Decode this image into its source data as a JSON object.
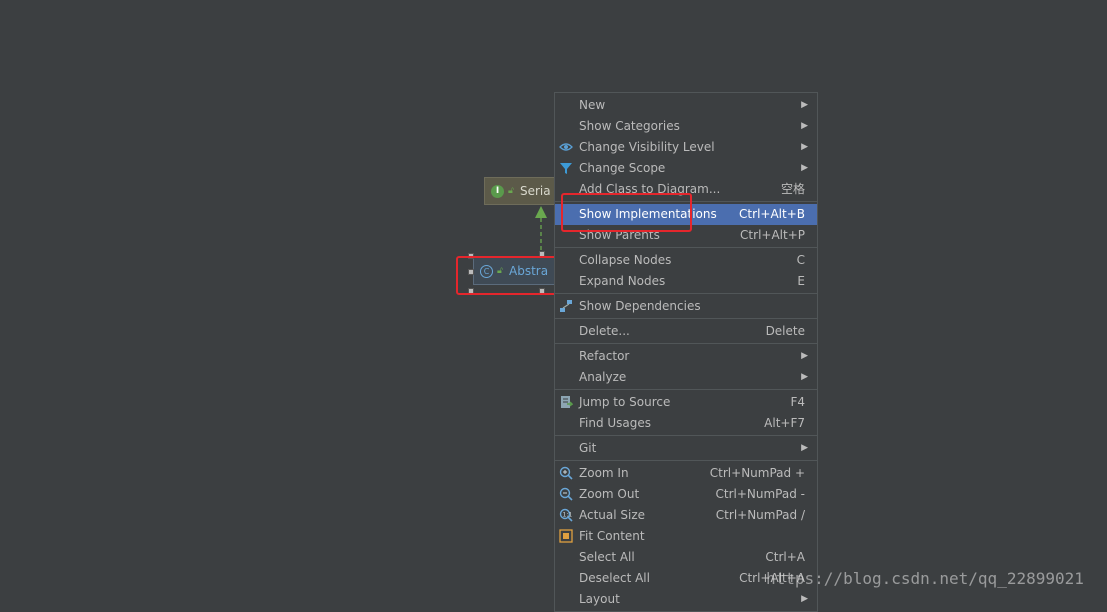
{
  "diagram": {
    "nodes": [
      {
        "label": "Seria",
        "badge": "I"
      },
      {
        "label": "Abstra",
        "badge": "C"
      }
    ]
  },
  "menu": {
    "groups": [
      [
        {
          "label": "New",
          "shortcut": "",
          "submenu": true,
          "icon": ""
        },
        {
          "label": "Show Categories",
          "shortcut": "",
          "submenu": true,
          "icon": ""
        },
        {
          "label": "Change Visibility Level",
          "shortcut": "",
          "submenu": true,
          "icon": "eye-filter-icon"
        },
        {
          "label": "Change Scope",
          "shortcut": "",
          "submenu": true,
          "icon": "funnel-icon"
        },
        {
          "label": "Add Class to Diagram...",
          "shortcut": "空格",
          "submenu": false,
          "icon": ""
        }
      ],
      [
        {
          "label": "Show Implementations",
          "shortcut": "Ctrl+Alt+B",
          "submenu": false,
          "icon": "",
          "selected": true
        },
        {
          "label": "Show Parents",
          "shortcut": "Ctrl+Alt+P",
          "submenu": false,
          "icon": ""
        }
      ],
      [
        {
          "label": "Collapse Nodes",
          "shortcut": "C",
          "submenu": false,
          "icon": ""
        },
        {
          "label": "Expand Nodes",
          "shortcut": "E",
          "submenu": false,
          "icon": ""
        }
      ],
      [
        {
          "label": "Show Dependencies",
          "shortcut": "",
          "submenu": false,
          "icon": "dependencies-icon"
        }
      ],
      [
        {
          "label": "Delete...",
          "shortcut": "Delete",
          "submenu": false,
          "icon": ""
        }
      ],
      [
        {
          "label": "Refactor",
          "shortcut": "",
          "submenu": true,
          "icon": ""
        },
        {
          "label": "Analyze",
          "shortcut": "",
          "submenu": true,
          "icon": ""
        }
      ],
      [
        {
          "label": "Jump to Source",
          "shortcut": "F4",
          "submenu": false,
          "icon": "jump-source-icon"
        },
        {
          "label": "Find Usages",
          "shortcut": "Alt+F7",
          "submenu": false,
          "icon": ""
        }
      ],
      [
        {
          "label": "Git",
          "shortcut": "",
          "submenu": true,
          "icon": ""
        }
      ],
      [
        {
          "label": "Zoom In",
          "shortcut": "Ctrl+NumPad +",
          "submenu": false,
          "icon": "zoom-in-icon"
        },
        {
          "label": "Zoom Out",
          "shortcut": "Ctrl+NumPad -",
          "submenu": false,
          "icon": "zoom-out-icon"
        },
        {
          "label": "Actual Size",
          "shortcut": "Ctrl+NumPad /",
          "submenu": false,
          "icon": "actual-size-icon"
        },
        {
          "label": "Fit Content",
          "shortcut": "",
          "submenu": false,
          "icon": "fit-content-icon"
        },
        {
          "label": "Select All",
          "shortcut": "Ctrl+A",
          "submenu": false,
          "icon": ""
        },
        {
          "label": "Deselect All",
          "shortcut": "Ctrl+Alt+A",
          "submenu": false,
          "icon": ""
        },
        {
          "label": "Layout",
          "shortcut": "",
          "submenu": true,
          "icon": ""
        }
      ]
    ]
  },
  "watermark": "https://blog.csdn.net/qq_22899021",
  "colors": {
    "background": "#3c3f41",
    "selection": "#4b6eaf",
    "highlight_box": "#e5262c",
    "arrow": "#6aa84f"
  }
}
